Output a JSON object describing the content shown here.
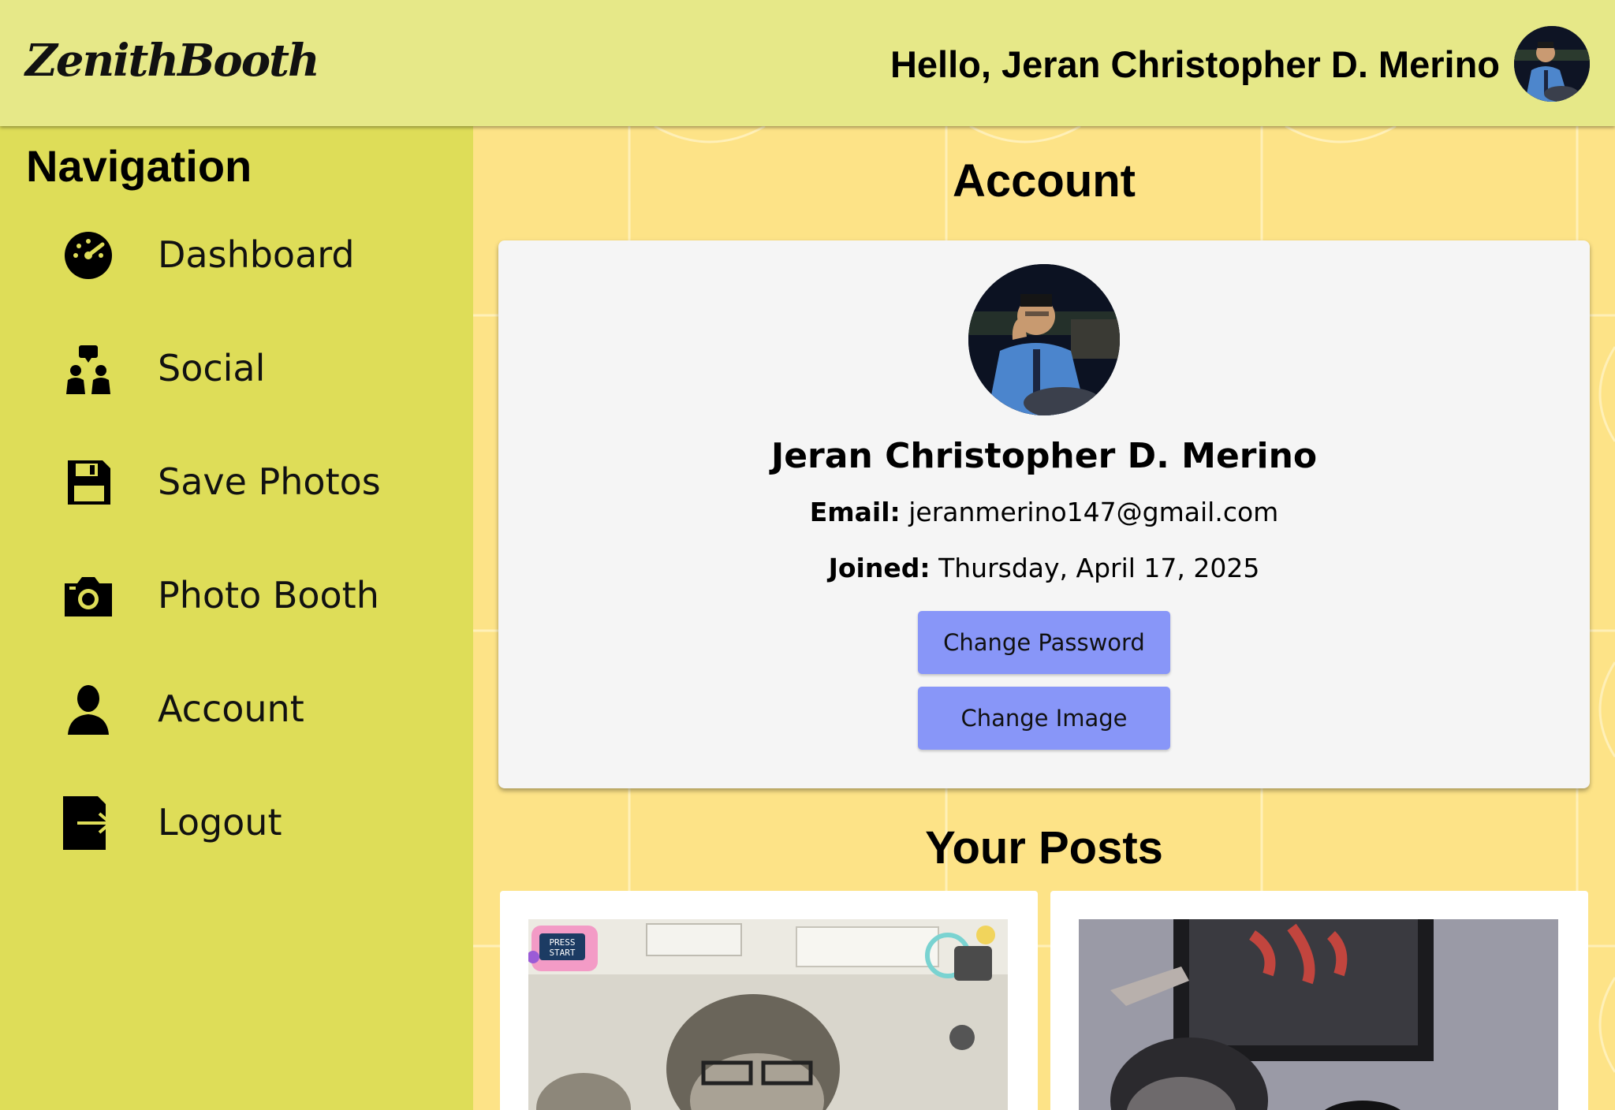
{
  "header": {
    "logo": "ZenithBooth",
    "greeting": "Hello, Jeran Christopher D. Merino"
  },
  "sidebar": {
    "title": "Navigation",
    "items": [
      {
        "label": "Dashboard",
        "icon": "dashboard-gauge-icon"
      },
      {
        "label": "Social",
        "icon": "social-users-icon"
      },
      {
        "label": "Save Photos",
        "icon": "floppy-disk-icon"
      },
      {
        "label": "Photo Booth",
        "icon": "camera-icon"
      },
      {
        "label": "Account",
        "icon": "user-icon"
      },
      {
        "label": "Logout",
        "icon": "logout-icon"
      }
    ]
  },
  "account": {
    "title": "Account",
    "name": "Jeran Christopher D. Merino",
    "email_label": "Email:",
    "email": "jeranmerino147@gmail.com",
    "joined_label": "Joined:",
    "joined": "Thursday, April 17, 2025",
    "change_password": "Change Password",
    "change_image": "Change Image"
  },
  "posts": {
    "title": "Your Posts",
    "sticker_text": "PRESS START"
  },
  "colors": {
    "header_bg": "#e6e888",
    "sidebar_bg": "#dedd58",
    "main_bg": "#fde387",
    "card_bg": "#f5f5f5",
    "button_bg": "#8896f8"
  }
}
